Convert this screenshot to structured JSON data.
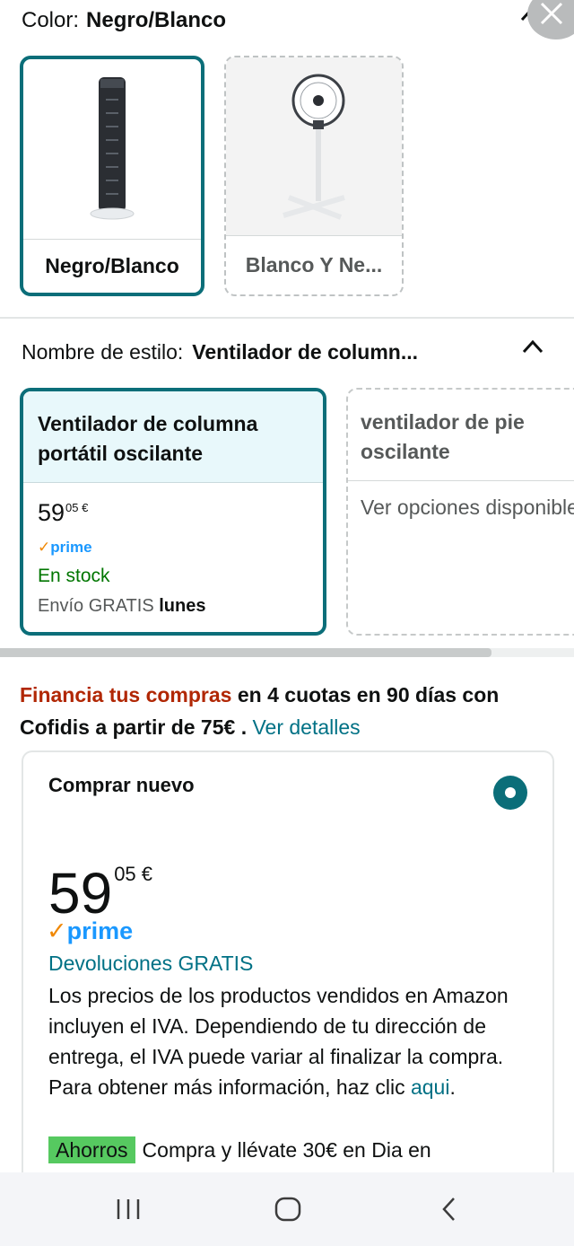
{
  "color": {
    "label": "Color:",
    "value": "Negro/Blanco"
  },
  "color_swatches": [
    {
      "label": "Negro/Blanco",
      "selected": true
    },
    {
      "label": "Blanco Y Ne...",
      "selected": false
    }
  ],
  "style": {
    "label": "Nombre de estilo:",
    "value": "Ventilador de column..."
  },
  "style_options": [
    {
      "name_line1": "Ventilador de columna",
      "name_line2": "portátil oscilante",
      "price_whole": "59",
      "price_fraction": "05 €",
      "prime_check": "✓",
      "prime": "prime",
      "stock": "En stock",
      "shipping": "Envío GRATIS",
      "shipping_day": "lunes"
    },
    {
      "name_line1": "ventilador de pie",
      "name_line2": "oscilante",
      "availability": "Ver opciones disponibles"
    }
  ],
  "financing": {
    "highlight": "Financia tus compras",
    "text": " en 4 cuotas en 90 días con Cofidis a partir de 75€ . ",
    "link": "Ver detalles"
  },
  "buy_new": {
    "title": "Comprar nuevo",
    "price_whole": "59",
    "price_fraction": "05 €",
    "prime_check": "✓",
    "prime": "prime",
    "returns": "Devoluciones GRATIS",
    "vat_text": "Los precios de los productos vendidos en Amazon incluyen el IVA. Dependiendo de tu dirección de entrega, el IVA puede variar al finalizar la compra. Para obtener más información, haz clic ",
    "vat_link": "aqui",
    "vat_end": ".",
    "savings_badge": "Ahorros",
    "savings_text": "Compra y llévate 30€ en Dia en"
  },
  "colors": {
    "accent": "#0b6e79",
    "link": "#007185",
    "prime": "#1a98ff",
    "stock": "#007600",
    "deal": "#b12704",
    "savings": "#56c960"
  },
  "icons": [
    "chevron-up-icon",
    "close-icon",
    "recent-apps-icon",
    "home-icon",
    "back-icon"
  ]
}
